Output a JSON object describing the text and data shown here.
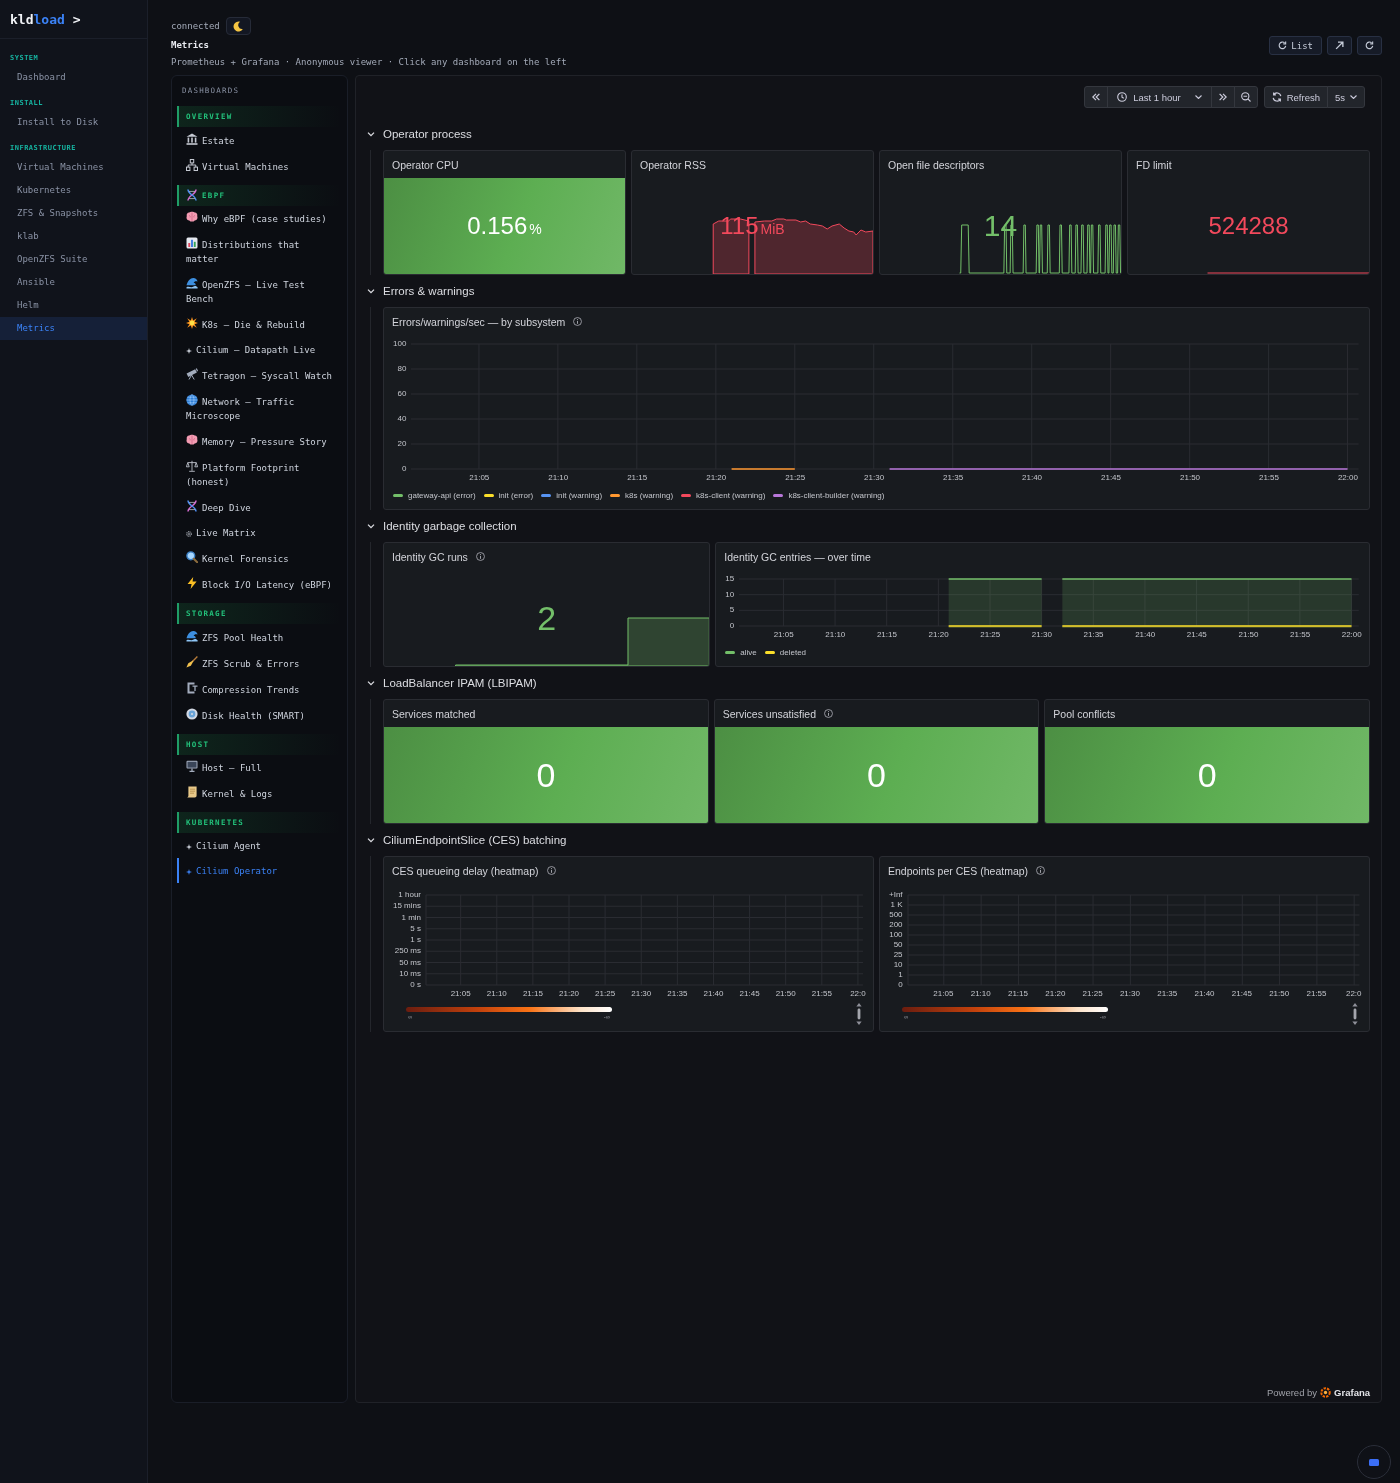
{
  "sidebar": {
    "logo": {
      "text": "kld",
      "highlight": "load",
      "caret": ">"
    },
    "sections": [
      {
        "heading": "SYSTEM",
        "items": [
          {
            "label": "Dashboard",
            "selected": false
          }
        ]
      },
      {
        "heading": "INSTALL",
        "items": [
          {
            "label": "Install to Disk",
            "selected": false
          }
        ]
      },
      {
        "heading": "INFRASTRUCTURE",
        "items": [
          {
            "label": "Virtual Machines",
            "selected": false
          },
          {
            "label": "Kubernetes",
            "selected": false
          },
          {
            "label": "ZFS & Snapshots",
            "selected": false
          },
          {
            "label": "klab",
            "selected": false
          },
          {
            "label": "OpenZFS Suite",
            "selected": false
          },
          {
            "label": "Ansible",
            "selected": false
          },
          {
            "label": "Helm",
            "selected": false
          },
          {
            "label": "Metrics",
            "selected": true
          }
        ]
      }
    ]
  },
  "header": {
    "status": "connected",
    "title": "Metrics",
    "subtitle": "Prometheus + Grafana · Anonymous viewer · Click any dashboard on the left",
    "list_button": "List"
  },
  "dashboards": {
    "heading": "DASHBOARDS",
    "groups": [
      {
        "title": "OVERVIEW",
        "items": [
          {
            "label": "Estate",
            "selected": false
          },
          {
            "label": "Virtual Machines",
            "selected": false
          }
        ]
      },
      {
        "title": "EBPF",
        "items": [
          {
            "label": "Why eBPF (case studies)",
            "selected": false
          },
          {
            "label": "Distributions that matter",
            "selected": false
          },
          {
            "label": "OpenZFS — Live Test Bench",
            "selected": false
          },
          {
            "label": "K8s — Die & Rebuild",
            "selected": false
          },
          {
            "label": "Cilium — Datapath Live",
            "selected": false
          },
          {
            "label": "Tetragon — Syscall Watch",
            "selected": false
          },
          {
            "label": "Network — Traffic Microscope",
            "selected": false
          },
          {
            "label": "Memory — Pressure Story",
            "selected": false
          },
          {
            "label": "Platform Footprint (honest)",
            "selected": false
          },
          {
            "label": "Deep Dive",
            "selected": false
          },
          {
            "label": "Live Matrix",
            "selected": false
          },
          {
            "label": "Kernel Forensics",
            "selected": false
          },
          {
            "label": "Block I/O Latency (eBPF)",
            "selected": false
          }
        ]
      },
      {
        "title": "STORAGE",
        "items": [
          {
            "label": "ZFS Pool Health",
            "selected": false
          },
          {
            "label": "ZFS Scrub & Errors",
            "selected": false
          },
          {
            "label": "Compression Trends",
            "selected": false
          },
          {
            "label": "Disk Health (SMART)",
            "selected": false
          }
        ]
      },
      {
        "title": "HOST",
        "items": [
          {
            "label": "Host — Full",
            "selected": false
          },
          {
            "label": "Kernel & Logs",
            "selected": false
          }
        ]
      },
      {
        "title": "KUBERNETES",
        "items": [
          {
            "label": "Cilium Agent",
            "selected": false
          },
          {
            "label": "Cilium Operator",
            "selected": true
          }
        ]
      }
    ]
  },
  "grafana": {
    "time_range": "Last 1 hour",
    "refresh_label": "Refresh",
    "refresh_interval": "5s",
    "rows": [
      {
        "title": "Operator process",
        "expanded": true,
        "panels": [
          {
            "kind": "stat",
            "title": "Operator CPU",
            "info": false,
            "filled": true,
            "value": "0.156",
            "unit": "%",
            "color": "#5dae52"
          },
          {
            "kind": "stat",
            "title": "Operator RSS",
            "info": false,
            "filled": false,
            "value": "115",
            "unit": "MiB",
            "color": "#f2495c"
          },
          {
            "kind": "stat",
            "title": "Open file descriptors",
            "info": false,
            "filled": false,
            "value": "14",
            "color": "#73bf69"
          },
          {
            "kind": "stat",
            "title": "FD limit",
            "info": false,
            "filled": false,
            "value": "524288",
            "color": "#f2495c"
          }
        ]
      },
      {
        "title": "Errors & warnings",
        "expanded": true,
        "panels": [
          {
            "kind": "timeseries",
            "title": "Errors/warnings/sec — by subsystem",
            "info": true,
            "chart_data": {
              "type": "line",
              "grid": true,
              "legend": "bottom",
              "categories": [
                null,
                null,
                null,
                null,
                "21:05",
                null,
                null,
                null,
                null,
                "21:10",
                null,
                null,
                null,
                null,
                "21:15",
                null,
                null,
                null,
                null,
                "21:20",
                null,
                null,
                null,
                null,
                "21:25",
                null,
                null,
                null,
                null,
                "21:30",
                null,
                null,
                null,
                null,
                "21:35",
                null,
                null,
                null,
                null,
                "21:40",
                null,
                null,
                null,
                null,
                "21:45",
                null,
                null,
                null,
                null,
                "21:50",
                null,
                null,
                null,
                null,
                "21:55",
                null,
                null,
                null,
                null,
                "22:00"
              ],
              "ylim": [
                0,
                100
              ],
              "yticks": [
                0,
                20,
                40,
                60,
                80,
                100
              ],
              "series": [
                {
                  "name": "gateway-api (error)",
                  "color": "#73bf69",
                  "values": [
                    null,
                    null,
                    null,
                    null,
                    null,
                    null,
                    null,
                    null,
                    null,
                    null,
                    null,
                    null,
                    null,
                    null,
                    null,
                    null,
                    null,
                    null,
                    null,
                    null,
                    null,
                    null,
                    null,
                    null,
                    null,
                    null,
                    null,
                    null,
                    null,
                    null,
                    null,
                    null,
                    null,
                    null,
                    null,
                    null,
                    null,
                    null,
                    null,
                    null,
                    null,
                    null,
                    null,
                    null,
                    null,
                    null,
                    null,
                    null,
                    null,
                    null,
                    null,
                    null,
                    null,
                    null,
                    null,
                    null,
                    null,
                    null,
                    null,
                    null
                  ]
                },
                {
                  "name": "init (error)",
                  "color": "#fade2a",
                  "values": [
                    null,
                    null,
                    null,
                    null,
                    null,
                    null,
                    null,
                    null,
                    null,
                    null,
                    null,
                    null,
                    null,
                    null,
                    null,
                    null,
                    null,
                    null,
                    null,
                    null,
                    null,
                    null,
                    null,
                    null,
                    null,
                    null,
                    null,
                    null,
                    null,
                    null,
                    null,
                    null,
                    null,
                    null,
                    null,
                    null,
                    null,
                    null,
                    null,
                    null,
                    null,
                    null,
                    null,
                    null,
                    null,
                    null,
                    null,
                    null,
                    null,
                    null,
                    null,
                    null,
                    null,
                    null,
                    null,
                    null,
                    null,
                    null,
                    null,
                    null
                  ]
                },
                {
                  "name": "init (warning)",
                  "color": "#5794f2",
                  "values": [
                    null,
                    null,
                    null,
                    null,
                    null,
                    null,
                    null,
                    null,
                    null,
                    null,
                    null,
                    null,
                    null,
                    null,
                    null,
                    null,
                    null,
                    null,
                    null,
                    null,
                    null,
                    null,
                    null,
                    null,
                    null,
                    null,
                    null,
                    null,
                    null,
                    null,
                    null,
                    null,
                    null,
                    null,
                    null,
                    null,
                    null,
                    null,
                    null,
                    null,
                    null,
                    null,
                    null,
                    null,
                    null,
                    null,
                    null,
                    null,
                    null,
                    null,
                    null,
                    null,
                    null,
                    null,
                    null,
                    null,
                    null,
                    null,
                    null,
                    null
                  ]
                },
                {
                  "name": "k8s (warning)",
                  "color": "#ff9830",
                  "values": [
                    null,
                    null,
                    null,
                    null,
                    null,
                    null,
                    null,
                    null,
                    null,
                    null,
                    null,
                    null,
                    null,
                    null,
                    null,
                    null,
                    null,
                    null,
                    null,
                    null,
                    0,
                    0,
                    0,
                    0,
                    0,
                    null,
                    null,
                    null,
                    null,
                    null,
                    null,
                    null,
                    null,
                    null,
                    null,
                    null,
                    null,
                    null,
                    null,
                    null,
                    null,
                    null,
                    null,
                    null,
                    null,
                    null,
                    null,
                    null,
                    null,
                    null,
                    null,
                    null,
                    null,
                    null,
                    null,
                    null,
                    null,
                    null,
                    null,
                    null
                  ]
                },
                {
                  "name": "k8s-client (warning)",
                  "color": "#f2495c",
                  "values": [
                    null,
                    null,
                    null,
                    null,
                    null,
                    null,
                    null,
                    null,
                    null,
                    null,
                    null,
                    null,
                    null,
                    null,
                    null,
                    null,
                    null,
                    null,
                    null,
                    null,
                    null,
                    null,
                    null,
                    null,
                    null,
                    null,
                    null,
                    null,
                    null,
                    null,
                    null,
                    null,
                    null,
                    null,
                    null,
                    null,
                    null,
                    null,
                    null,
                    null,
                    null,
                    null,
                    null,
                    null,
                    null,
                    null,
                    null,
                    null,
                    null,
                    null,
                    null,
                    null,
                    null,
                    null,
                    null,
                    null,
                    null,
                    null,
                    null,
                    null
                  ]
                },
                {
                  "name": "k8s-client-builder (warning)",
                  "color": "#b877d9",
                  "values": [
                    null,
                    null,
                    null,
                    null,
                    null,
                    null,
                    null,
                    null,
                    null,
                    null,
                    null,
                    null,
                    null,
                    null,
                    null,
                    null,
                    null,
                    null,
                    null,
                    null,
                    null,
                    null,
                    null,
                    null,
                    null,
                    null,
                    null,
                    null,
                    null,
                    null,
                    0,
                    0,
                    0,
                    0,
                    0,
                    0,
                    0,
                    0,
                    0,
                    0,
                    0,
                    0,
                    0,
                    0,
                    0,
                    0,
                    0,
                    0,
                    0,
                    0,
                    0,
                    0,
                    0,
                    0,
                    0,
                    0,
                    0,
                    0,
                    0,
                    0
                  ]
                }
              ]
            }
          }
        ]
      },
      {
        "title": "Identity garbage collection",
        "expanded": true,
        "panels": [
          {
            "kind": "stat",
            "title": "Identity GC runs",
            "info": true,
            "filled": false,
            "value": "2",
            "color": "#73bf69"
          },
          {
            "kind": "timeseries",
            "title": "Identity GC entries — over time",
            "info": false,
            "chart_data": {
              "type": "area",
              "grid": true,
              "legend": "bottom",
              "categories": [
                null,
                null,
                null,
                null,
                "21:05",
                null,
                null,
                null,
                null,
                "21:10",
                null,
                null,
                null,
                null,
                "21:15",
                null,
                null,
                null,
                null,
                "21:20",
                null,
                null,
                null,
                null,
                "21:25",
                null,
                null,
                null,
                null,
                "21:30",
                null,
                null,
                null,
                null,
                "21:35",
                null,
                null,
                null,
                null,
                "21:40",
                null,
                null,
                null,
                null,
                "21:45",
                null,
                null,
                null,
                null,
                "21:50",
                null,
                null,
                null,
                null,
                "21:55",
                null,
                null,
                null,
                null,
                "22:00"
              ],
              "ylim": [
                0,
                15
              ],
              "yticks": [
                0,
                5,
                10,
                15
              ],
              "series": [
                {
                  "name": "alive",
                  "color": "#73bf69",
                  "values": [
                    null,
                    null,
                    null,
                    null,
                    null,
                    null,
                    null,
                    null,
                    null,
                    null,
                    null,
                    null,
                    null,
                    null,
                    null,
                    null,
                    null,
                    null,
                    null,
                    null,
                    15,
                    15,
                    15,
                    15,
                    15,
                    15,
                    15,
                    15,
                    15,
                    15,
                    null,
                    15,
                    15,
                    15,
                    15,
                    15,
                    15,
                    15,
                    15,
                    15,
                    15,
                    15,
                    15,
                    15,
                    15,
                    15,
                    15,
                    15,
                    15,
                    15,
                    15,
                    15,
                    15,
                    15,
                    15,
                    15,
                    15,
                    15,
                    15,
                    15
                  ]
                },
                {
                  "name": "deleted",
                  "color": "#fade2a",
                  "values": [
                    null,
                    null,
                    null,
                    null,
                    null,
                    null,
                    null,
                    null,
                    null,
                    null,
                    null,
                    null,
                    null,
                    null,
                    null,
                    null,
                    null,
                    null,
                    null,
                    null,
                    0,
                    0,
                    0,
                    0,
                    0,
                    0,
                    0,
                    0,
                    0,
                    0,
                    null,
                    0,
                    0,
                    0,
                    0,
                    0,
                    0,
                    0,
                    0,
                    0,
                    0,
                    0,
                    0,
                    0,
                    0,
                    0,
                    0,
                    0,
                    0,
                    0,
                    0,
                    0,
                    0,
                    0,
                    0,
                    0,
                    0,
                    0,
                    0,
                    0
                  ]
                }
              ]
            }
          }
        ]
      },
      {
        "title": "LoadBalancer IPAM (LBIPAM)",
        "expanded": true,
        "panels": [
          {
            "kind": "stat",
            "title": "Services matched",
            "info": false,
            "filled": true,
            "value": "0",
            "color": "#5dae52"
          },
          {
            "kind": "stat",
            "title": "Services unsatisfied",
            "info": true,
            "filled": true,
            "value": "0",
            "color": "#5dae52"
          },
          {
            "kind": "stat",
            "title": "Pool conflicts",
            "info": false,
            "filled": true,
            "value": "0",
            "color": "#5dae52"
          }
        ]
      },
      {
        "title": "CiliumEndpointSlice (CES) batching",
        "expanded": true,
        "panels": [
          {
            "kind": "heatmap",
            "title": "CES queueing delay (heatmap)",
            "info": true,
            "y_labels": [
              "1 hour",
              "15 mins",
              "1 min",
              "5 s",
              "1 s",
              "250 ms",
              "50 ms",
              "10 ms",
              "0 s"
            ],
            "x_labels": [
              "21:05",
              "21:10",
              "21:15",
              "21:20",
              "21:25",
              "21:30",
              "21:35",
              "21:40",
              "21:45",
              "21:50",
              "21:55",
              "22:0"
            ],
            "scale_min": "∞",
            "scale_max": "-∞"
          },
          {
            "kind": "heatmap",
            "title": "Endpoints per CES (heatmap)",
            "info": true,
            "y_labels": [
              "+Inf",
              "1 K",
              "500",
              "200",
              "100",
              "50",
              "25",
              "10",
              "1",
              "0"
            ],
            "x_labels": [
              "21:05",
              "21:10",
              "21:15",
              "21:20",
              "21:25",
              "21:30",
              "21:35",
              "21:40",
              "21:45",
              "21:50",
              "21:55",
              "22:0"
            ],
            "scale_min": "∞",
            "scale_max": "-∞"
          }
        ]
      }
    ],
    "footer": {
      "powered_by": "Powered by",
      "brand": "Grafana"
    }
  }
}
